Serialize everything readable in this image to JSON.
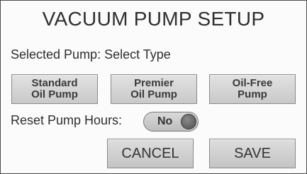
{
  "title": "VACUUM PUMP SETUP",
  "selected_pump": {
    "text": "Selected Pump: Select Type"
  },
  "pump_options": [
    {
      "line1": "Standard",
      "line2": "Oil Pump"
    },
    {
      "line1": "Premier",
      "line2": "Oil Pump"
    },
    {
      "line1": "Oil-Free",
      "line2": "Pump"
    }
  ],
  "reset_hours": {
    "label": "Reset Pump Hours:",
    "toggle_value": "No"
  },
  "actions": {
    "cancel": "CANCEL",
    "save": "SAVE"
  }
}
